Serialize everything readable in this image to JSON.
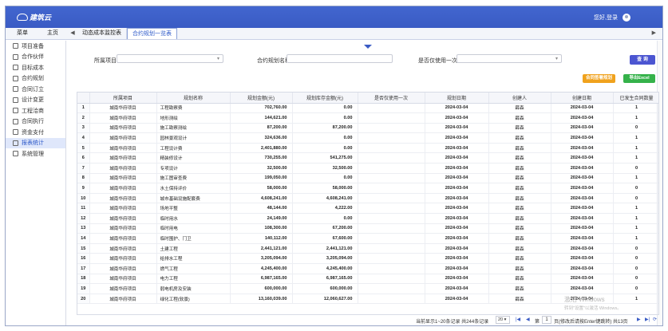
{
  "header": {
    "logo": "建筑云",
    "user_greeting": "您好,登录"
  },
  "tabbar": {
    "menu": "菜单",
    "home": "主页",
    "tabs": [
      "动态成本监控表",
      "合约规划一览表"
    ],
    "active_tab": 1
  },
  "sidebar": {
    "items": [
      "项目准备",
      "合作伙伴",
      "目标成本",
      "合约规划",
      "合同订立",
      "设计变更",
      "工程洽商",
      "合同执行",
      "资金支付",
      "报表统计",
      "系统管理"
    ],
    "active": 9
  },
  "filters": {
    "project_label": "所属项目:",
    "plan_label": "合约规划名称:",
    "once_label": "是否仅使用一次:",
    "query": "查 询"
  },
  "actions": {
    "orange": "合同签署规划",
    "green": "导出Excel"
  },
  "table": {
    "columns": [
      "",
      "所属项目",
      "规划名称",
      "规划金额(元)",
      "规划库存金额(元)",
      "是否仅使用一次",
      "规划日期",
      "创建人",
      "创建日期",
      "已发生合同数量"
    ],
    "rows": [
      [
        "1",
        "城南华府项目",
        "工程勘察费",
        "702,760.00",
        "0.00",
        "",
        "2024-03-04",
        "薛森",
        "2024-03-04",
        "1"
      ],
      [
        "2",
        "城南华府项目",
        "地形测绘",
        "144,621.00",
        "0.00",
        "",
        "2024-03-04",
        "薛森",
        "2024-03-04",
        "1"
      ],
      [
        "3",
        "城南华府项目",
        "施工勘察测绘",
        "87,200.00",
        "87,200.00",
        "",
        "2024-03-04",
        "薛森",
        "2024-03-04",
        "0"
      ],
      [
        "4",
        "城南华府项目",
        "园林景观设计",
        "324,636.00",
        "0.00",
        "",
        "2024-03-04",
        "薛森",
        "2024-03-04",
        "1"
      ],
      [
        "5",
        "城南华府项目",
        "工程设计费",
        "2,401,880.00",
        "0.00",
        "",
        "2024-03-04",
        "薛森",
        "2024-03-04",
        "1"
      ],
      [
        "6",
        "城南华府项目",
        "精装修设计",
        "730,255.00",
        "541,275.00",
        "",
        "2024-03-04",
        "薛森",
        "2024-03-04",
        "1"
      ],
      [
        "7",
        "城南华府项目",
        "专项设计",
        "32,500.00",
        "32,500.00",
        "",
        "2024-03-04",
        "薛森",
        "2024-03-04",
        "0"
      ],
      [
        "8",
        "城南华府项目",
        "施工图审查费",
        "199,050.00",
        "0.00",
        "",
        "2024-03-04",
        "薛森",
        "2024-03-04",
        "1"
      ],
      [
        "9",
        "城南华府项目",
        "水土保持评价",
        "58,000.00",
        "58,000.00",
        "",
        "2024-03-04",
        "薛森",
        "2024-03-04",
        "0"
      ],
      [
        "10",
        "城南华府项目",
        "城市基础设施配套费",
        "4,608,241.00",
        "4,608,241.00",
        "",
        "2024-03-04",
        "薛森",
        "2024-03-04",
        "0"
      ],
      [
        "11",
        "城南华府项目",
        "场地平整",
        "48,144.00",
        "4,222.00",
        "",
        "2024-03-04",
        "薛森",
        "2024-03-04",
        "1"
      ],
      [
        "12",
        "城南华府项目",
        "临时用水",
        "24,149.00",
        "0.00",
        "",
        "2024-03-04",
        "薛森",
        "2024-03-04",
        "1"
      ],
      [
        "13",
        "城南华府项目",
        "临时用电",
        "108,300.00",
        "67,200.00",
        "",
        "2024-03-04",
        "薛森",
        "2024-03-04",
        "1"
      ],
      [
        "14",
        "城南华府项目",
        "临时围护、门卫",
        "140,112.00",
        "67,600.00",
        "",
        "2024-03-04",
        "薛森",
        "2024-03-04",
        "1"
      ],
      [
        "15",
        "城南华府项目",
        "土建工程",
        "2,441,121.00",
        "2,441,121.00",
        "",
        "2024-03-04",
        "薛森",
        "2024-03-04",
        "0"
      ],
      [
        "16",
        "城南华府项目",
        "给排水工程",
        "3,205,094.00",
        "3,205,094.00",
        "",
        "2024-03-04",
        "薛森",
        "2024-03-04",
        "0"
      ],
      [
        "17",
        "城南华府项目",
        "燃气工程",
        "4,245,400.00",
        "4,245,400.00",
        "",
        "2024-03-04",
        "薛森",
        "2024-03-04",
        "0"
      ],
      [
        "18",
        "城南华府项目",
        "电力工程",
        "6,987,165.00",
        "6,987,165.00",
        "",
        "2024-03-04",
        "薛森",
        "2024-03-04",
        "0"
      ],
      [
        "19",
        "城南华府项目",
        "弱电机房及安装",
        "600,000.00",
        "600,000.00",
        "",
        "2024-03-04",
        "薛森",
        "2024-03-04",
        "0"
      ],
      [
        "20",
        "城南华府项目",
        "绿化工程(软景)",
        "13,160,039.00",
        "12,060,627.00",
        "",
        "2024-03-04",
        "薛森",
        "2024-03-04",
        "1"
      ]
    ]
  },
  "pager": {
    "info": "当前显示1~20条记录 共244条记录",
    "page_size": "20",
    "page_prefix": "第",
    "page_value": "1",
    "page_suffix": "页(修改后请按Enter键跳转) 共13页"
  },
  "watermark": {
    "line1": "激活 Windows",
    "line2": "转到\"设置\"以激活 Windows。"
  }
}
